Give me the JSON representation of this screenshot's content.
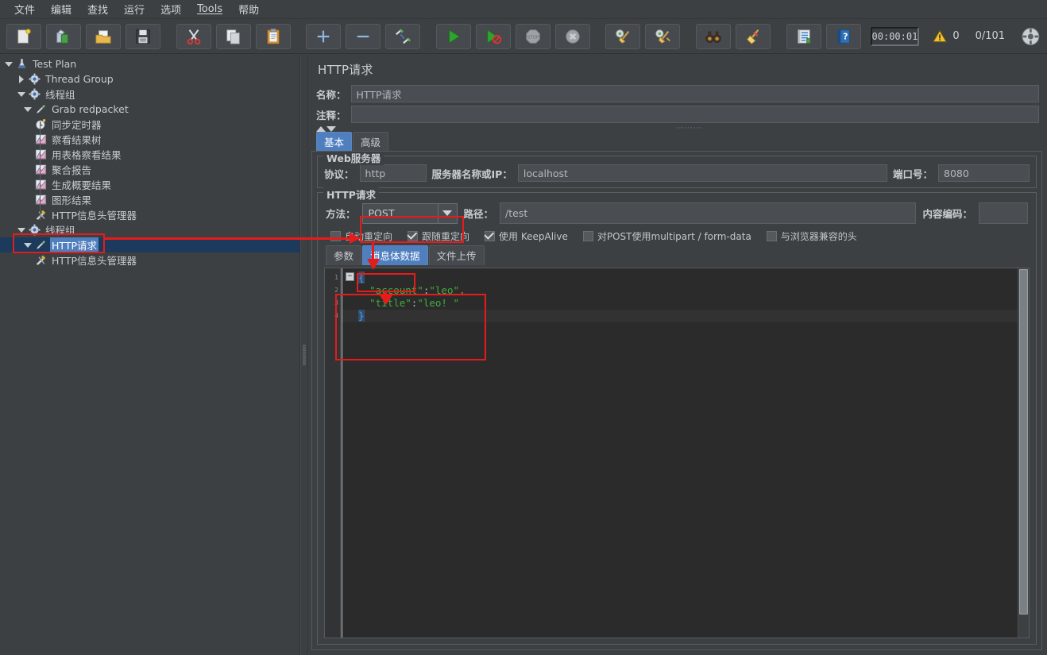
{
  "menubar": {
    "items": [
      {
        "label": "文件"
      },
      {
        "label": "编辑"
      },
      {
        "label": "查找"
      },
      {
        "label": "运行"
      },
      {
        "label": "选项"
      },
      {
        "label": "Tools"
      },
      {
        "label": "帮助"
      }
    ]
  },
  "toolbar": {
    "buttons": [
      {
        "name": "new-test-plan",
        "icon": "new-document-icon"
      },
      {
        "name": "templates",
        "icon": "templates-icon"
      },
      {
        "name": "open",
        "icon": "open-folder-icon"
      },
      {
        "name": "save",
        "icon": "floppy-save-icon"
      },
      {
        "name": "cut",
        "icon": "scissors-icon"
      },
      {
        "name": "copy",
        "icon": "copy-icon"
      },
      {
        "name": "paste",
        "icon": "clipboard-paste-icon"
      },
      {
        "name": "expand-all",
        "icon": "plus-icon"
      },
      {
        "name": "collapse-all",
        "icon": "minus-icon"
      },
      {
        "name": "toggle",
        "icon": "toggle-pencil-icon"
      },
      {
        "name": "start",
        "icon": "green-play-icon"
      },
      {
        "name": "start-no-pauses",
        "icon": "play-no-pause-icon"
      },
      {
        "name": "stop",
        "icon": "stop-sign-icon"
      },
      {
        "name": "shutdown",
        "icon": "shutdown-x-icon"
      },
      {
        "name": "clear",
        "icon": "gear-broom-icon"
      },
      {
        "name": "clear-all",
        "icon": "gear-broom-all-icon"
      },
      {
        "name": "search",
        "icon": "binoculars-icon"
      },
      {
        "name": "reset-search",
        "icon": "broom-icon"
      },
      {
        "name": "function-helper",
        "icon": "notebook-list-icon"
      },
      {
        "name": "help",
        "icon": "blue-help-book-icon"
      }
    ],
    "timer": "00:00:01",
    "warning_icon": "warning-triangle-icon",
    "warning_count": "0",
    "threads": "0/101",
    "nav_icon": "compass-nav-icon"
  },
  "tree": {
    "nodes": [
      {
        "label": "Test Plan",
        "depth": 0,
        "twist": "down",
        "icon": "test-plan-flask-icon",
        "selected": false
      },
      {
        "label": "Thread Group",
        "depth": 1,
        "twist": "right",
        "icon": "thread-group-gear-icon",
        "selected": false
      },
      {
        "label": "线程组",
        "depth": 1,
        "twist": "down",
        "icon": "thread-group-gear-icon",
        "selected": false
      },
      {
        "label": "Grab redpacket",
        "depth": 2,
        "twist": "down",
        "icon": "http-sampler-pencil-icon",
        "selected": false
      },
      {
        "label": "同步定时器",
        "depth": 3,
        "twist": "none",
        "icon": "timer-clock-icon",
        "selected": false
      },
      {
        "label": "察看结果树",
        "depth": 3,
        "twist": "none",
        "icon": "listener-chart-icon",
        "selected": false
      },
      {
        "label": "用表格察看结果",
        "depth": 3,
        "twist": "none",
        "icon": "listener-chart-icon",
        "selected": false
      },
      {
        "label": "聚合报告",
        "depth": 3,
        "twist": "none",
        "icon": "listener-chart-icon",
        "selected": false
      },
      {
        "label": "生成概要结果",
        "depth": 3,
        "twist": "none",
        "icon": "listener-chart-icon",
        "selected": false
      },
      {
        "label": "图形结果",
        "depth": 3,
        "twist": "none",
        "icon": "listener-chart-icon",
        "selected": false
      },
      {
        "label": "HTTP信息头管理器",
        "depth": 3,
        "twist": "none",
        "icon": "header-manager-tools-icon",
        "selected": false
      },
      {
        "label": "线程组",
        "depth": 1,
        "twist": "down",
        "icon": "thread-group-gear-icon",
        "selected": false
      },
      {
        "label": "HTTP请求",
        "depth": 2,
        "twist": "down",
        "icon": "http-sampler-pencil-icon",
        "selected": true
      },
      {
        "label": "HTTP信息头管理器",
        "depth": 3,
        "twist": "none",
        "icon": "header-manager-tools-icon",
        "selected": false
      }
    ]
  },
  "panel": {
    "title": "HTTP请求",
    "name_label": "名称：",
    "name_value": "HTTP请求",
    "comment_label": "注释：",
    "comment_value": "",
    "tabs": [
      {
        "label": "基本",
        "active": true
      },
      {
        "label": "高级",
        "active": false
      }
    ],
    "webserver": {
      "legend": "Web服务器",
      "protocol_label": "协议：",
      "protocol_value": "http",
      "server_label": "服务器名称或IP：",
      "server_value": "localhost",
      "port_label": "端口号：",
      "port_value": "8080"
    },
    "httprequest": {
      "legend": "HTTP请求",
      "method_label": "方法：",
      "method_value": "POST",
      "path_label": "路径：",
      "path_value": "/test",
      "encoding_label": "内容编码：",
      "encoding_value": "",
      "checkboxes": [
        {
          "label": "自动重定向",
          "checked": false
        },
        {
          "label": "跟随重定向",
          "checked": true
        },
        {
          "label": "使用 KeepAlive",
          "checked": true
        },
        {
          "label": "对POST使用multipart / form-data",
          "checked": false
        },
        {
          "label": "与浏览器兼容的头",
          "checked": false
        }
      ],
      "body_tabs": [
        {
          "label": "参数",
          "active": false
        },
        {
          "label": "消息体数据",
          "active": true
        },
        {
          "label": "文件上传",
          "active": false
        }
      ],
      "editor": {
        "line_numbers": [
          "1",
          "2",
          "3",
          "4"
        ],
        "lines": [
          {
            "indent": 0,
            "text": "{",
            "type": "brace"
          },
          {
            "indent": 1,
            "text": "\"account\":\"leo\",",
            "type": "kv"
          },
          {
            "indent": 1,
            "text": "\"title\":\"leo! \"",
            "type": "kv"
          },
          {
            "indent": 0,
            "text": "}",
            "type": "brace"
          }
        ],
        "raw": "{\n    \"account\":\"leo\",\n    \"title\":\"leo! \"\n}"
      }
    }
  },
  "colors": {
    "accent_selection": "#4f7fbf",
    "annotation_red": "#e81b1b",
    "panel_bg": "#3c4043",
    "editor_bg": "#2b2b2b",
    "string_green": "#3fae3f"
  }
}
